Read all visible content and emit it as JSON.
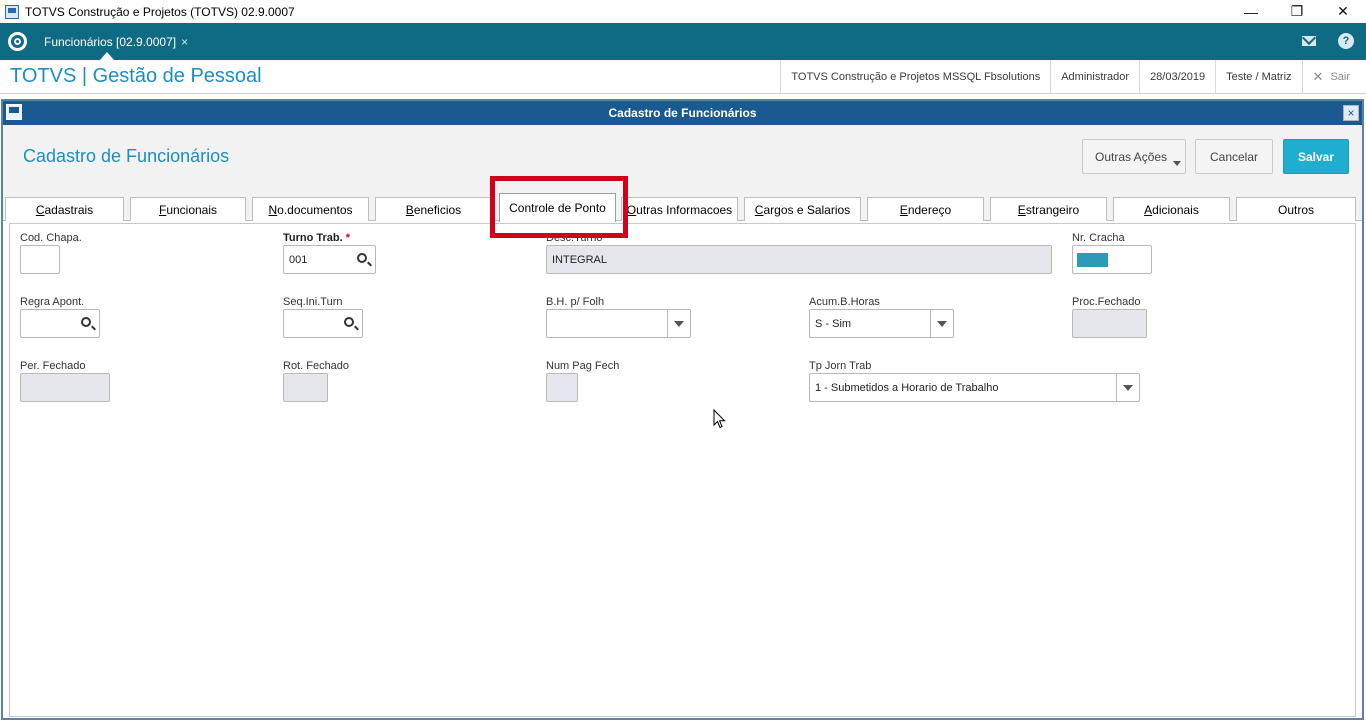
{
  "os": {
    "title": "TOTVS Construção e Projetos (TOTVS) 02.9.0007",
    "minimize": "—",
    "restore": "❐",
    "close": "✕"
  },
  "tabbar": {
    "tab_label": "Funcionários [02.9.0007]",
    "tab_close": "×",
    "help": "?"
  },
  "header": {
    "title": "TOTVS | Gestão de Pessoal",
    "company": "TOTVS Construção e Projetos MSSQL Fbsolutions",
    "user": "Administrador",
    "date": "28/03/2019",
    "branch": "Teste / Matriz",
    "exit_icon": "✕",
    "exit": "Sair"
  },
  "dialog": {
    "title": "Cadastro de Funcionários",
    "close": "×",
    "form_title": "Cadastro de Funcionários",
    "buttons": {
      "more": "Outras Ações",
      "cancel": "Cancelar",
      "save": "Salvar"
    }
  },
  "tabs": [
    {
      "u": "C",
      "rest": "adastrais"
    },
    {
      "u": "F",
      "rest": "uncionais"
    },
    {
      "u": "N",
      "rest": "o.documentos"
    },
    {
      "u": "B",
      "rest": "eneficios"
    },
    {
      "u": "",
      "rest": "Controle de Ponto"
    },
    {
      "u": "O",
      "rest": "utras Informacoes"
    },
    {
      "u": "C",
      "rest": "argos e Salarios"
    },
    {
      "u": "E",
      "rest": "ndereço"
    },
    {
      "u": "E",
      "rest": "strangeiro"
    },
    {
      "u": "A",
      "rest": "dicionais"
    },
    {
      "u": "",
      "rest": "Outros"
    }
  ],
  "form": {
    "cod_chapa": {
      "label": "Cod. Chapa.",
      "value": ""
    },
    "turno_trab": {
      "label": "Turno Trab. ",
      "required": "*",
      "value": "001"
    },
    "desc_turno": {
      "label": "Desc.Turno",
      "value": "INTEGRAL"
    },
    "nr_cracha": {
      "label": "Nr. Cracha",
      "color": "#2f9ab7"
    },
    "regra_apont": {
      "label": "Regra Apont.",
      "value": ""
    },
    "seq_ini_turn": {
      "label": "Seq.Ini.Turn",
      "value": ""
    },
    "bh_folh": {
      "label": "B.H. p/ Folh",
      "value": ""
    },
    "acum_b_horas": {
      "label": "Acum.B.Horas",
      "value": "S - Sim"
    },
    "proc_fechado": {
      "label": "Proc.Fechado",
      "value": ""
    },
    "per_fechado": {
      "label": "Per. Fechado",
      "value": ""
    },
    "rot_fechado": {
      "label": "Rot. Fechado",
      "value": ""
    },
    "num_pag_fech": {
      "label": "Num Pag Fech",
      "value": ""
    },
    "tp_jorn_trab": {
      "label": "Tp Jorn Trab",
      "value": "1 - Submetidos a Horario de Trabalho"
    }
  },
  "colors": {
    "teal_bar": "#0f6a84",
    "brand_blue": "#1c8fbf",
    "dialog_title": "#1b5a90",
    "save_button": "#1faed0",
    "highlight": "#d0021b"
  }
}
